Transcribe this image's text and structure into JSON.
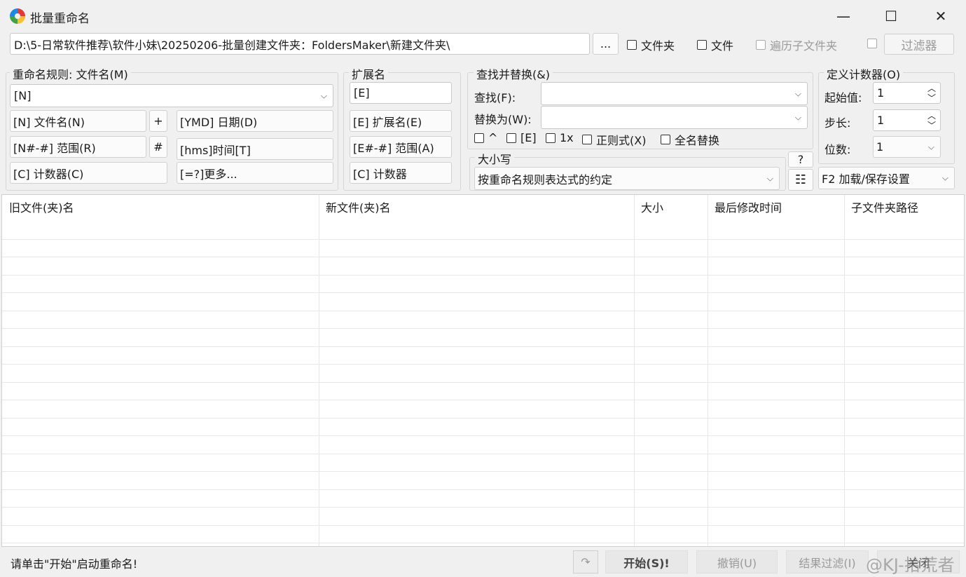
{
  "window": {
    "title": "批量重命名"
  },
  "path": {
    "value": "D:\\5-日常软件推荐\\软件小妹\\20250206-批量创建文件夹：FoldersMaker\\新建文件夹\\",
    "browse_label": "..."
  },
  "top_options": {
    "folder": "文件夹",
    "file": "文件",
    "subfolders": "遍历子文件夹",
    "filter": "过滤器"
  },
  "rename_rule": {
    "label": "重命名规则: 文件名(M)",
    "value": "[N]",
    "buttons": [
      "[N] 文件名(N)",
      "+",
      "[YMD] 日期(D)",
      "[N#-#] 范围(R)",
      "#",
      "[hms]时间[T]",
      "[C] 计数器(C)",
      "[=?]更多..."
    ]
  },
  "extension": {
    "label": "扩展名",
    "value": "[E]",
    "buttons": [
      "[E] 扩展名(E)",
      "[E#-#] 范围(A)",
      "[C] 计数器"
    ]
  },
  "find_replace": {
    "label": "查找并替换(&)",
    "find_label": "查找(F):",
    "replace_label": "替换为(W):",
    "find_value": "",
    "replace_value": "",
    "options": [
      "^",
      "[E]",
      "1x",
      "正则式(X)",
      "全名替换"
    ]
  },
  "case": {
    "label": "大小写",
    "value": "按重命名规则表达式的约定",
    "help": "?"
  },
  "counter": {
    "label": "定义计数器(O)",
    "start_label": "起始值:",
    "start_value": "1",
    "step_label": "步长:",
    "step_value": "1",
    "digits_label": "位数:",
    "digits_value": "1"
  },
  "settings": {
    "label": "F2 加载/保存设置"
  },
  "table": {
    "columns": [
      "旧文件(夹)名",
      "新文件(夹)名",
      "大小",
      "最后修改时间",
      "子文件夹路径"
    ],
    "rows": []
  },
  "status": {
    "message": "请单击\"开始\"启动重命名!",
    "start": "开始(S)!",
    "undo": "撤销(U)",
    "result": "结果过滤(I)",
    "close": "关闭"
  },
  "watermark": "@KJ-拾荒者",
  "colors": {
    "background": "#f0f0f0",
    "border": "#d0d0d0"
  }
}
